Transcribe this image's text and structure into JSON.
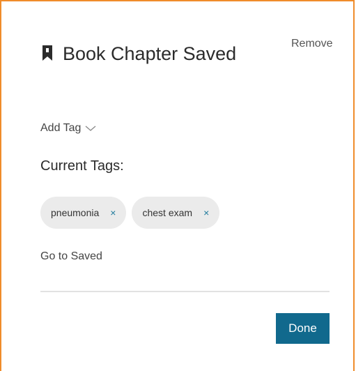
{
  "header": {
    "title": "Book Chapter Saved",
    "icon": "bookmark-icon"
  },
  "actions": {
    "remove_label": "Remove",
    "add_tag_label": "Add Tag",
    "go_to_saved_label": "Go to Saved",
    "done_label": "Done"
  },
  "tags": {
    "label": "Current Tags:",
    "items": [
      {
        "label": "pneumonia",
        "remove_glyph": "×"
      },
      {
        "label": "chest exam",
        "remove_glyph": "×"
      }
    ]
  },
  "colors": {
    "border": "#f08c2a",
    "accent": "#11698d",
    "chip_bg": "#ebebeb"
  }
}
